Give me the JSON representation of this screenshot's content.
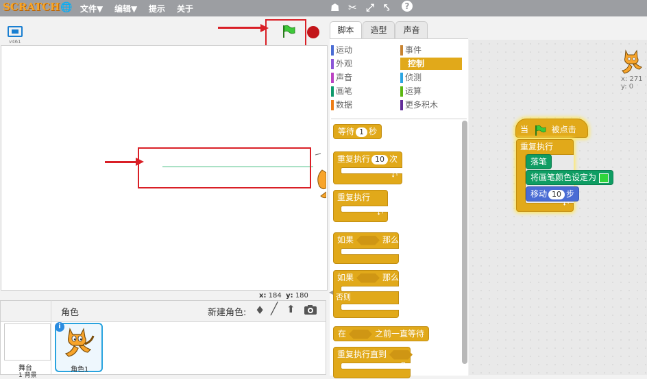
{
  "topbar": {
    "logo": "SCRATCH",
    "menus": [
      "文件▼",
      "编辑▼",
      "提示",
      "关于"
    ],
    "tools": [
      "duplicate-icon",
      "delete-icon",
      "grow-icon",
      "shrink-icon",
      "help-icon"
    ],
    "bg_color": "#9c9ea2"
  },
  "stage": {
    "version": "v461",
    "mouse_x_label": "x:",
    "mouse_x": "184",
    "mouse_y_label": "y:",
    "mouse_y": "180"
  },
  "sprites": {
    "title": "角色",
    "new_sprite_label": "新建角色:",
    "stage_label": "舞台",
    "stage_sub": "1 背景",
    "sprite_name": "角色1"
  },
  "tabs": [
    "脚本",
    "造型",
    "声音"
  ],
  "categories": [
    {
      "label": "运动",
      "color": "#4a6cd4"
    },
    {
      "label": "事件",
      "color": "#c88330"
    },
    {
      "label": "外观",
      "color": "#8a55d7"
    },
    {
      "label": "控制",
      "color": "#e1a91a",
      "selected": true
    },
    {
      "label": "声音",
      "color": "#bb42c3"
    },
    {
      "label": "侦测",
      "color": "#2ca5e2"
    },
    {
      "label": "画笔",
      "color": "#0e9a6c"
    },
    {
      "label": "运算",
      "color": "#5cb712"
    },
    {
      "label": "数据",
      "color": "#ee7d16"
    },
    {
      "label": "更多积木",
      "color": "#632d99"
    }
  ],
  "palette": {
    "wait_pre": "等待",
    "wait_val": "1",
    "wait_post": "秒",
    "repeat_pre": "重复执行",
    "repeat_val": "10",
    "repeat_post": "次",
    "forever": "重复执行",
    "if_pre": "如果",
    "if_post": "那么",
    "ifelse_pre": "如果",
    "ifelse_post": "那么",
    "else": "否则",
    "waituntil_pre": "在",
    "waituntil_post": "之前一直等待",
    "repeatuntil": "重复执行直到"
  },
  "script": {
    "hat_pre": "当",
    "hat_post": "被点击",
    "forever": "重复执行",
    "pendown": "落笔",
    "setcolor": "将画笔颜色设定为",
    "setcolor_value": "#2fd43c",
    "move_pre": "移动",
    "move_val": "10",
    "move_post": "步"
  },
  "sprite_info": {
    "x_label": "x:",
    "x": "271",
    "y_label": "y:",
    "y": "0"
  }
}
